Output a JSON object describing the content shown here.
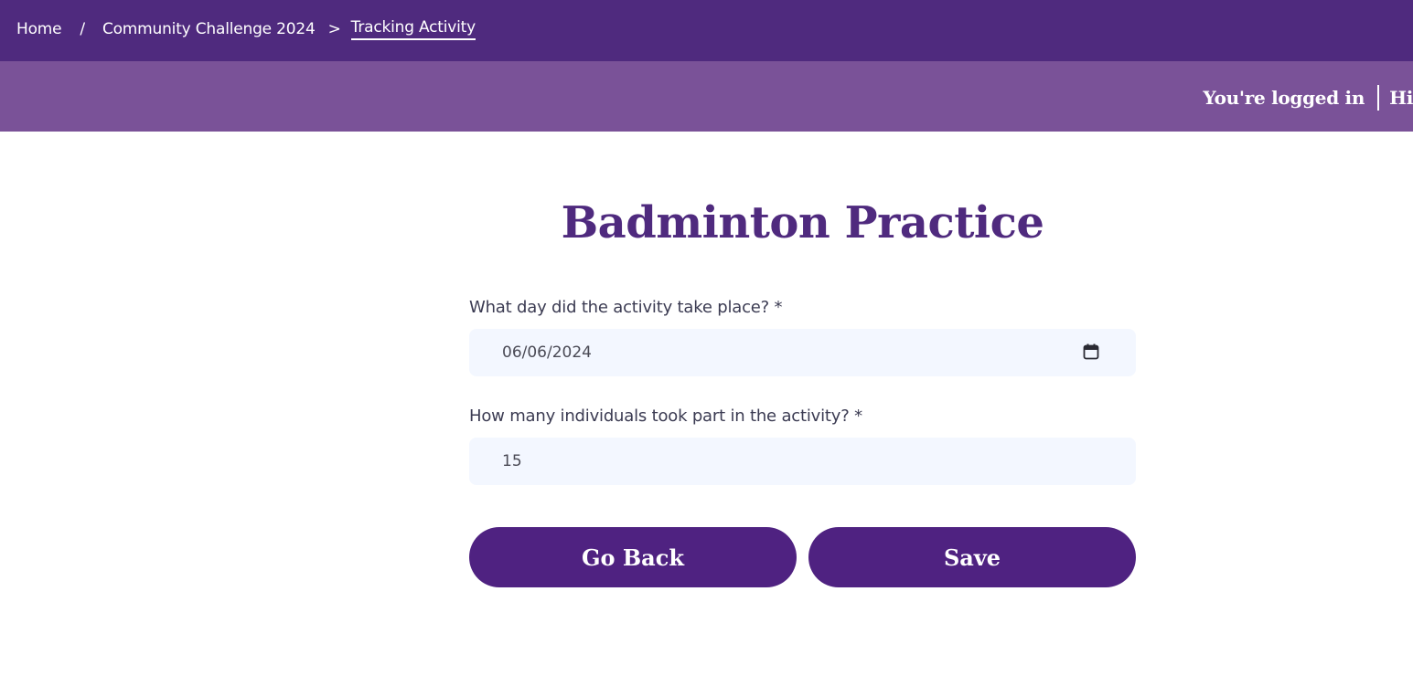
{
  "breadcrumb": {
    "home": "Home",
    "separator1": "/",
    "challenge": "Community Challenge 2024",
    "separator2": ">",
    "current": "Tracking Activity"
  },
  "header": {
    "login_text": "You're logged in",
    "greeting": "Hi"
  },
  "page": {
    "title": "Badminton Practice"
  },
  "form": {
    "date_label": "What day did the activity take place? *",
    "date_value": "06/06/2024",
    "calendar_icon": "calendar-icon",
    "count_label": "How many individuals took part in the activity? *",
    "count_value": "15"
  },
  "actions": {
    "back_label": "Go Back",
    "save_label": "Save"
  },
  "colors": {
    "topbar": "#4f2a7e",
    "subbar": "#7a5298",
    "title": "#4f2a7e",
    "button": "#4f2281",
    "input_bg": "#f3f7ff"
  }
}
